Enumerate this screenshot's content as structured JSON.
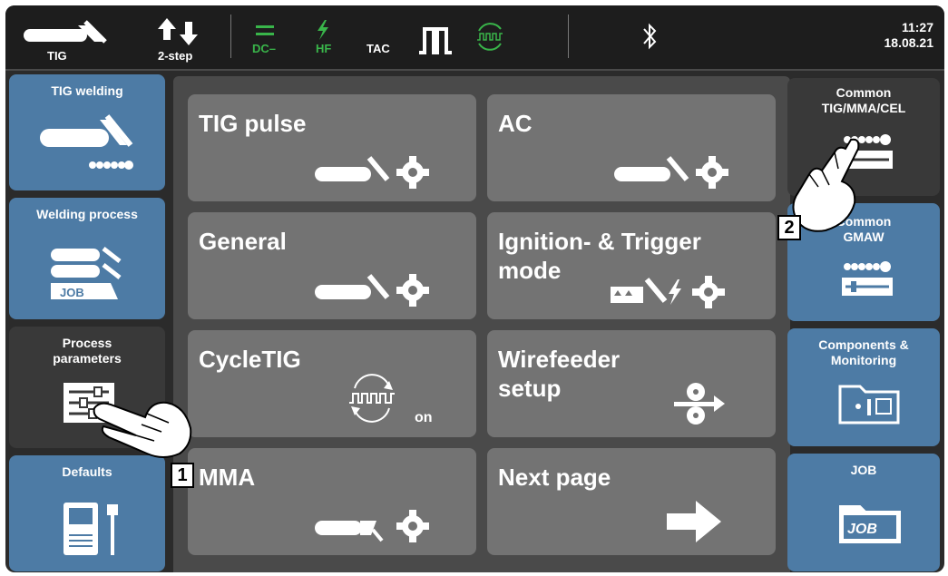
{
  "statusbar": {
    "process_label": "TIG",
    "mode_label": "2-step",
    "dc_label": "DC–",
    "hf_label": "HF",
    "tac_label": "TAC",
    "time": "11:27",
    "date": "18.08.21",
    "accent_green": "#39b54a"
  },
  "left_nav": [
    {
      "label": "TIG welding"
    },
    {
      "label": "Welding process",
      "sub": "JOB"
    },
    {
      "label": "Process\nparameters"
    },
    {
      "label": "Defaults"
    }
  ],
  "right_nav": [
    {
      "label": "Common\nTIG/MMA/CEL"
    },
    {
      "label": "Common\nGMAW"
    },
    {
      "label": "Components &\nMonitoring"
    },
    {
      "label": "JOB",
      "sub": "JOB"
    }
  ],
  "tiles": [
    {
      "label": "TIG pulse"
    },
    {
      "label": "AC"
    },
    {
      "label": "General"
    },
    {
      "label": "Ignition- & Trigger\nmode"
    },
    {
      "label": "CycleTIG",
      "badge": "on"
    },
    {
      "label": "Wirefeeder\nsetup"
    },
    {
      "label": "MMA"
    },
    {
      "label": "Next page"
    }
  ],
  "callouts": [
    "1",
    "2"
  ],
  "colors": {
    "blue_button": "#4d7ba5",
    "tile_gray": "#737373"
  }
}
